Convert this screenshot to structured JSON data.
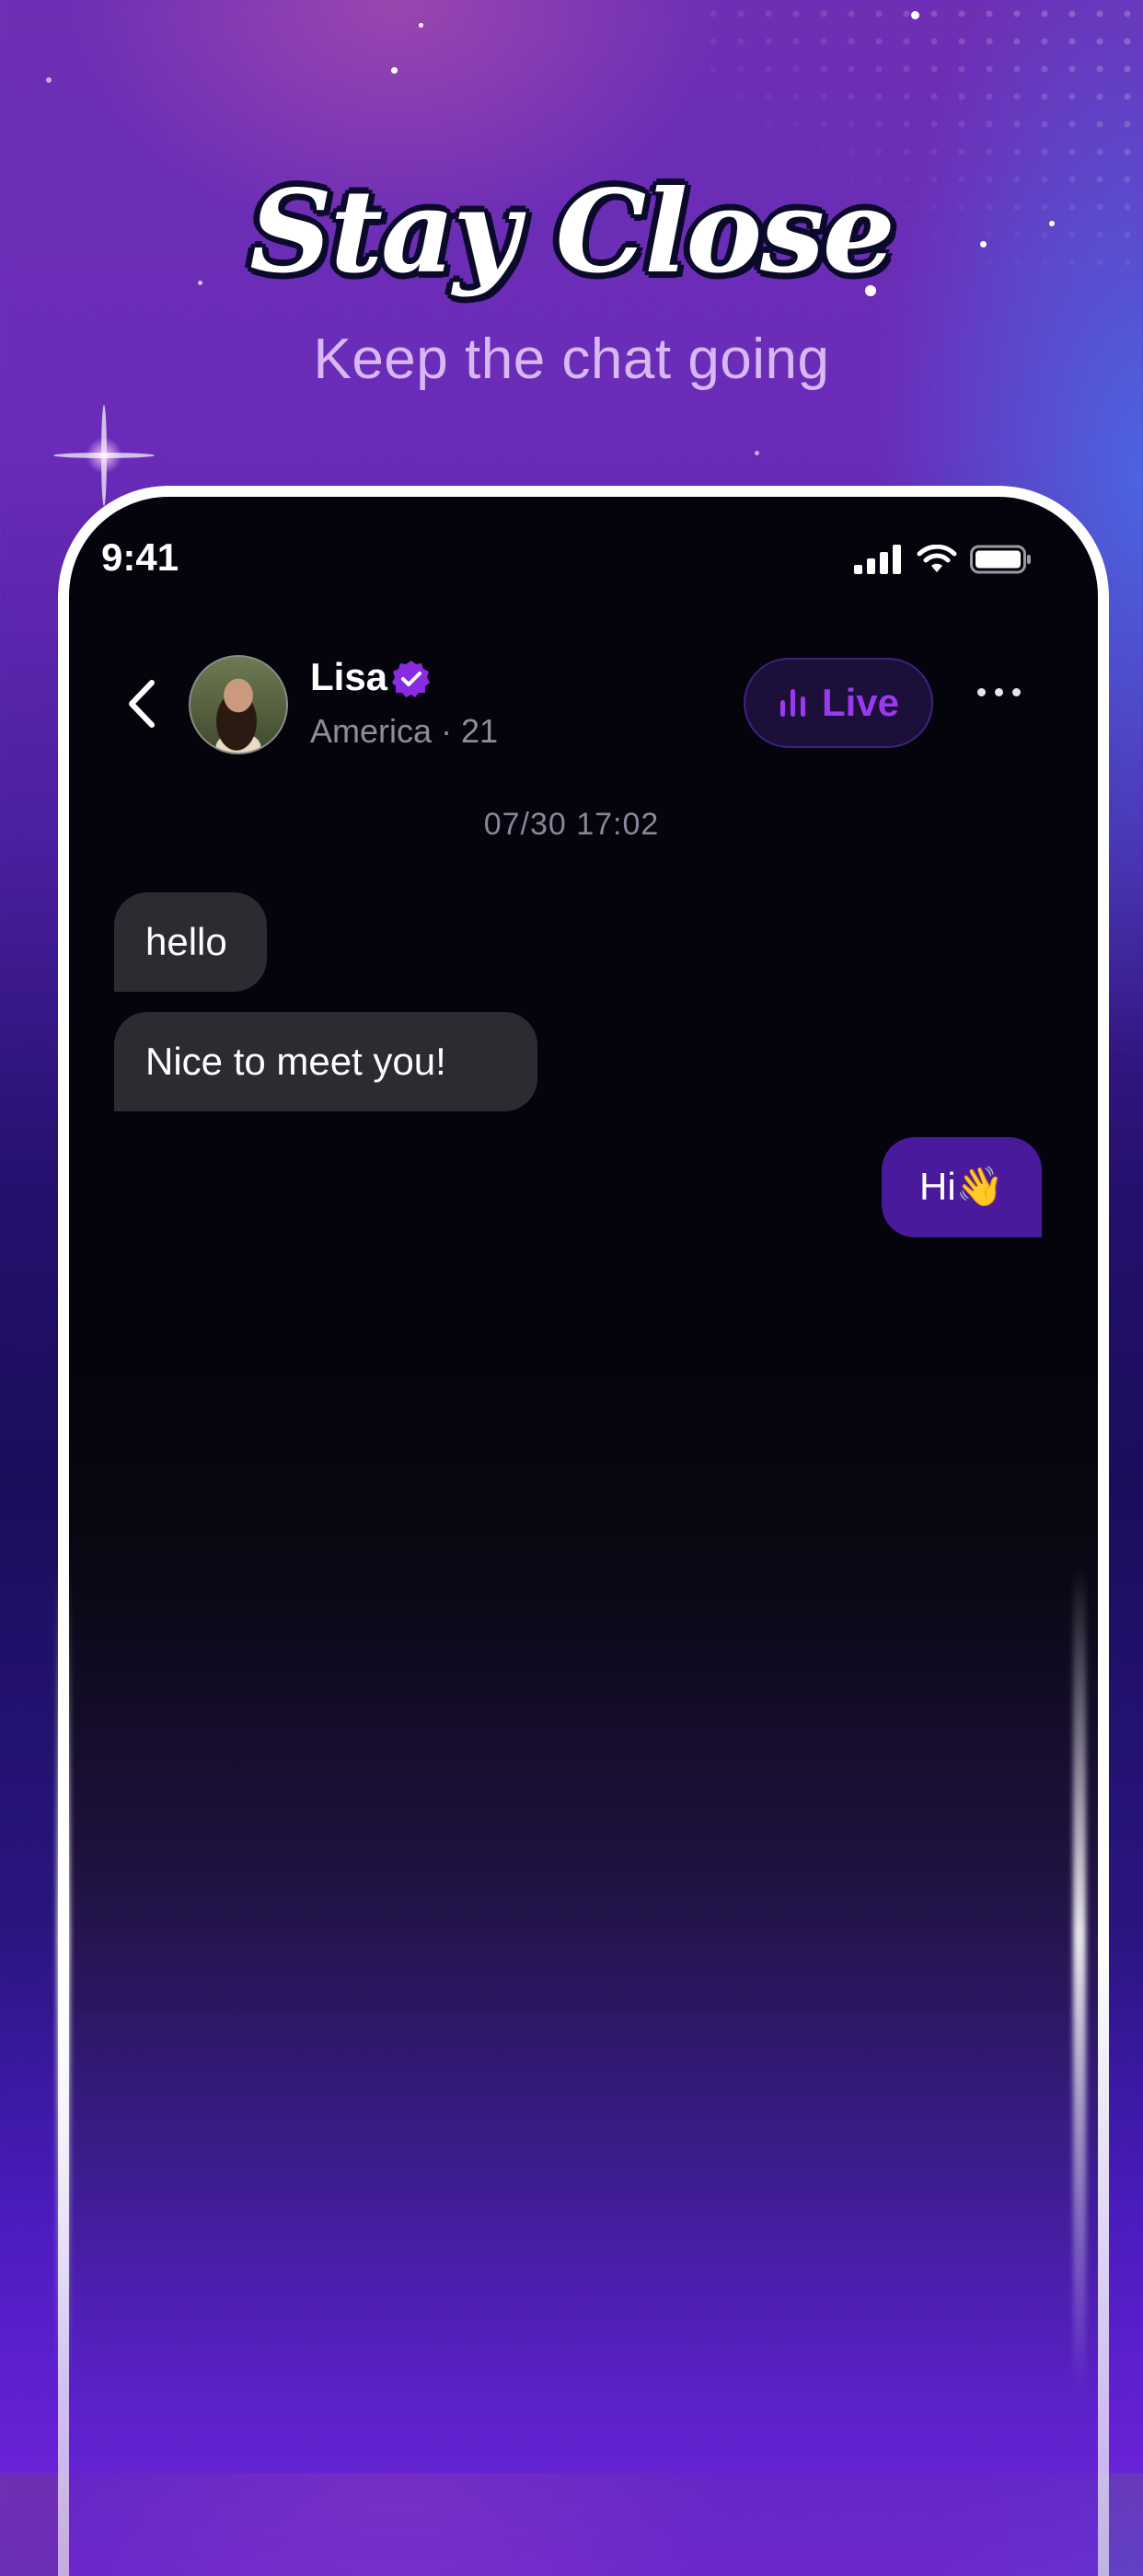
{
  "headline": "Stay Close",
  "subheadline": "Keep the chat going",
  "status_bar": {
    "time": "9:41",
    "icons": [
      "cellular-signal-icon",
      "wifi-icon",
      "battery-icon"
    ]
  },
  "chat_header": {
    "back_icon": "chevron-left-icon",
    "contact_name": "Lisa",
    "verified_icon": "verified-badge-icon",
    "contact_info": "America · 21",
    "live_button_label": "Live",
    "live_icon": "audio-bars-icon",
    "more_icon": "more-horizontal-icon"
  },
  "conversation": {
    "date_stamp": "07/30  17:02",
    "messages": [
      {
        "direction": "incoming",
        "text": "hello"
      },
      {
        "direction": "incoming",
        "text": "Nice to meet you!"
      },
      {
        "direction": "outgoing",
        "text": "Hi👋"
      }
    ]
  },
  "colors": {
    "accent_purple": "#9b39f0",
    "outgoing_bubble": "#4a1a9c",
    "incoming_bubble": "#2c2b31",
    "phone_bg": "#05040c"
  }
}
